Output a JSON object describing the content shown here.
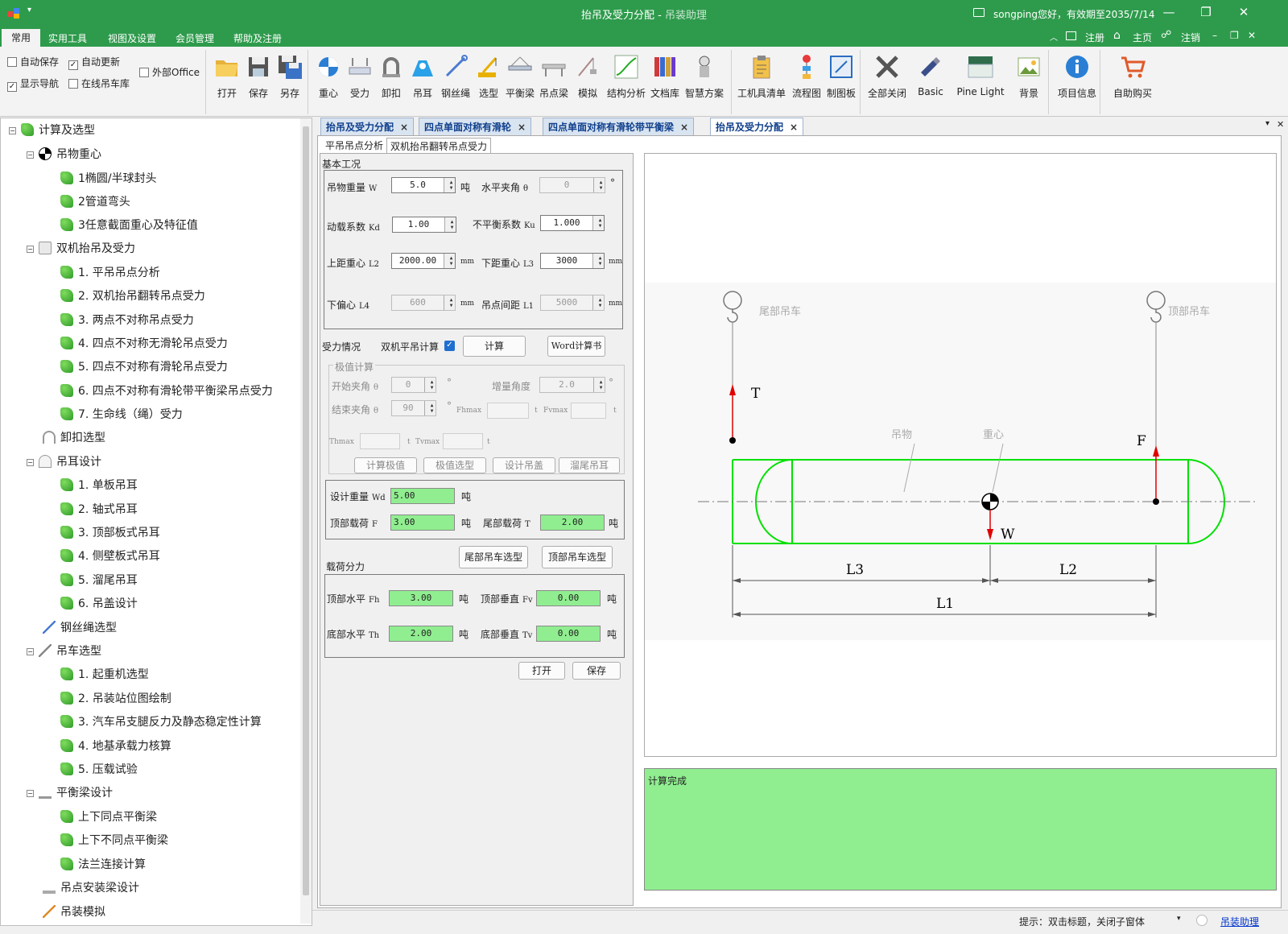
{
  "window": {
    "title": "抬吊及受力分配",
    "app_name": "吊装助理",
    "user_status": "songping您好，有效期至2035/7/14"
  },
  "menu": [
    "常用",
    "实用工具",
    "视图及设置",
    "会员管理",
    "帮助及注册"
  ],
  "menu_right": {
    "register": "注册",
    "home": "主页",
    "logout": "注销"
  },
  "options": {
    "auto_save": "自动保存",
    "auto_update": "自动更新",
    "show_nav": "显示导航",
    "online_crane": "在线吊车库",
    "external_office": "外部Office"
  },
  "ribbon": {
    "open": "打开",
    "save": "保存",
    "save_as": "另存",
    "cog": "重心",
    "force": "受力",
    "shackle": "卸扣",
    "lug": "吊耳",
    "wire": "钢丝绳",
    "select": "选型",
    "beam": "平衡梁",
    "lift_beam": "吊点梁",
    "simulate": "模拟",
    "structure": "结构分析",
    "doc_lib": "文档库",
    "smart": "智慧方案",
    "toollist": "工机具清单",
    "flow": "流程图",
    "board": "制图板",
    "close_all": "全部关闭",
    "theme": "Basic",
    "skin": "Pine Light",
    "background": "背景",
    "project": "项目信息",
    "buy": "自助购买"
  },
  "nav": {
    "root": "计算及选型",
    "items": [
      {
        "label": "吊物重心"
      },
      {
        "label": "1椭圆/半球封头"
      },
      {
        "label": "2管道弯头"
      },
      {
        "label": "3任意截面重心及特征值"
      },
      {
        "label": "双机抬吊及受力"
      },
      {
        "label": "1. 平吊吊点分析"
      },
      {
        "label": "2. 双机抬吊翻转吊点受力"
      },
      {
        "label": "3. 两点不对称吊点受力"
      },
      {
        "label": "4. 四点不对称无滑轮吊点受力"
      },
      {
        "label": "5. 四点不对称有滑轮吊点受力"
      },
      {
        "label": "6. 四点不对称有滑轮带平衡梁吊点受力"
      },
      {
        "label": "7. 生命线（绳）受力"
      },
      {
        "label": "卸扣选型"
      },
      {
        "label": "吊耳设计"
      },
      {
        "label": "1. 单板吊耳"
      },
      {
        "label": "2. 轴式吊耳"
      },
      {
        "label": "3. 顶部板式吊耳"
      },
      {
        "label": "4. 侧壁板式吊耳"
      },
      {
        "label": "5. 溜尾吊耳"
      },
      {
        "label": "6. 吊盖设计"
      },
      {
        "label": "钢丝绳选型"
      },
      {
        "label": "吊车选型"
      },
      {
        "label": "1. 起重机选型"
      },
      {
        "label": "2. 吊装站位图绘制"
      },
      {
        "label": "3. 汽车吊支腿反力及静态稳定性计算"
      },
      {
        "label": "4. 地基承载力核算"
      },
      {
        "label": "5. 压载试验"
      },
      {
        "label": "平衡梁设计"
      },
      {
        "label": "上下同点平衡梁"
      },
      {
        "label": "上下不同点平衡梁"
      },
      {
        "label": "法兰连接计算"
      },
      {
        "label": "吊点安装梁设计"
      },
      {
        "label": "吊装模拟"
      }
    ]
  },
  "doc_tabs": [
    "抬吊及受力分配",
    "四点单面对称有滑轮",
    "四点单面对称有滑轮带平衡梁",
    "抬吊及受力分配"
  ],
  "sub_tabs": [
    "平吊吊点分析",
    "双机抬吊翻转吊点受力"
  ],
  "basic": {
    "title": "基本工况",
    "weight_label": "吊物重量",
    "weight_sym": "W",
    "weight": "5.0",
    "weight_unit": "吨",
    "angle_label": "水平夹角",
    "angle_sym": "θ",
    "angle": "0",
    "angle_unit": "°",
    "kd_label": "动载系数",
    "kd_sym": "Kd",
    "kd": "1.00",
    "ku_label": "不平衡系数",
    "ku_sym": "Ku",
    "ku": "1.000",
    "l2_label": "上距重心",
    "l2_sym": "L2",
    "l2": "2000.00",
    "l2_unit": "mm",
    "l3_label": "下距重心",
    "l3_sym": "L3",
    "l3": "3000",
    "l3_unit": "mm",
    "l4_label": "下偏心",
    "l4_sym": "L4",
    "l4": "600",
    "l4_unit": "mm",
    "l1_label": "吊点间距",
    "l1_sym": "L1",
    "l1": "5000",
    "l1_unit": "mm"
  },
  "force": {
    "title": "受力情况",
    "dual_label": "双机平吊计算",
    "calc": "计算",
    "word": "Word计算书"
  },
  "extreme": {
    "title": "极值计算",
    "start_label": "开始夹角",
    "start_sym": "θ",
    "start": "0",
    "deg": "°",
    "inc_label": "增量角度",
    "inc": "2.0",
    "end_label": "结束夹角",
    "end_sym": "θ",
    "end": "90",
    "fhmax": "Fhmax",
    "fvmax": "Fvmax",
    "thmax": "Thmax",
    "tvmax": "Tvmax",
    "t": "t",
    "btn_calc": "计算极值",
    "btn_select": "极值选型",
    "btn_lid": "设计吊盖",
    "btn_tail": "溜尾吊耳"
  },
  "result": {
    "wd_label": "设计重量",
    "wd_sym": "Wd",
    "wd": "5.00",
    "ton": "吨",
    "top_label": "顶部载荷",
    "top_sym": "F",
    "top": "3.00",
    "tail_label": "尾部载荷",
    "tail_sym": "T",
    "tail": "2.00"
  },
  "split": {
    "title": "载荷分力",
    "btn_tail": "尾部吊车选型",
    "btn_top": "顶部吊车选型",
    "fh_label": "顶部水平",
    "fh_sym": "Fh",
    "fh": "3.00",
    "fv_label": "顶部垂直",
    "fv_sym": "Fv",
    "fv": "0.00",
    "th_label": "底部水平",
    "th_sym": "Th",
    "th": "2.00",
    "tv_label": "底部垂直",
    "tv_sym": "Tv",
    "tv": "0.00",
    "open": "打开",
    "save": "保存"
  },
  "diagram": {
    "tail_crane": "尾部吊车",
    "top_crane": "顶部吊车",
    "T": "T",
    "F": "F",
    "W": "W",
    "object": "吊物",
    "cog": "重心",
    "L1": "L1",
    "L2": "L2",
    "L3": "L3"
  },
  "status_text": "计算完成",
  "statusbar": {
    "hint": "提示：双击标题，关闭子窗体",
    "link": "吊装助理"
  },
  "colors": {
    "brand": "#2e9b4c",
    "result_green": "#90ee90",
    "outline_green": "#00e000",
    "arrow_red": "#e00000",
    "tab_blue": "#0f3f8c"
  }
}
